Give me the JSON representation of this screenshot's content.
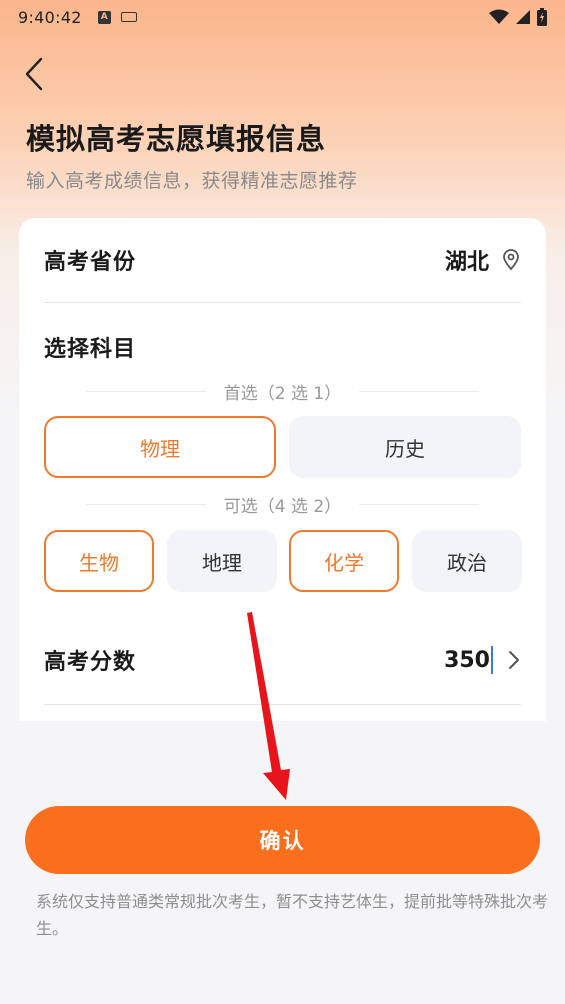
{
  "status_bar": {
    "time": "9:40:42",
    "a_badge": "A"
  },
  "header": {
    "back_icon": "chevron-left-icon",
    "title": "模拟高考志愿填报信息",
    "subtitle": "输入高考成绩信息，获得精准志愿推荐"
  },
  "province": {
    "label": "高考省份",
    "value": "湖北",
    "icon": "location-pin-icon"
  },
  "subjects": {
    "label": "选择科目",
    "primary": {
      "title": "首选（2 选 1）",
      "options": [
        "物理",
        "历史"
      ],
      "selected": [
        "物理"
      ]
    },
    "optional": {
      "title": "可选（4 选 2）",
      "options": [
        "生物",
        "地理",
        "化学",
        "政治"
      ],
      "selected": [
        "生物",
        "化学"
      ]
    }
  },
  "score": {
    "label": "高考分数",
    "value": "350",
    "icon": "chevron-right-icon"
  },
  "confirm_label": "确认",
  "notice": "系统仅支持普通类常规批次考生，暂不支持艺体生，提前批等特殊批次考生。",
  "colors": {
    "accent": "#f96f1e",
    "selected_border": "#f07a2e",
    "annotation_arrow": "#e8141b"
  }
}
